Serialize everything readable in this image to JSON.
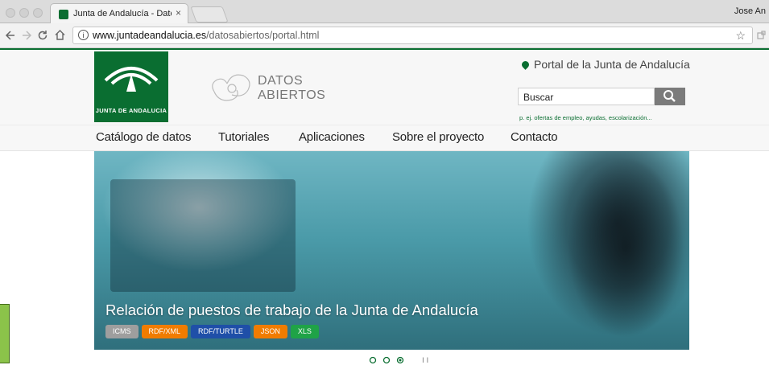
{
  "browser": {
    "tab_title": "Junta de Andalucía - Datos abi",
    "tab_close": "×",
    "user_name": "Jose An",
    "url_domain": "www.juntadeandalucia.es",
    "url_path": "/datosabiertos/portal.html",
    "info_glyph": "i",
    "star_glyph": "☆",
    "icons": [
      "back-arrow-icon",
      "forward-arrow-icon",
      "reload-icon",
      "home-icon",
      "info-icon",
      "star-icon",
      "extension-icon"
    ]
  },
  "header": {
    "logo_text": "JUNTA DE ANDALUCIA",
    "site_name_line1": "DATOS",
    "site_name_line2": "ABIERTOS",
    "portal_link": "Portal de la Junta de Andalucía",
    "search_value": "Buscar",
    "search_hint": "p. ej. ofertas de empleo, ayudas, escolarización..."
  },
  "nav": {
    "items": [
      {
        "label": "Catálogo de datos"
      },
      {
        "label": "Tutoriales"
      },
      {
        "label": "Aplicaciones"
      },
      {
        "label": "Sobre el proyecto"
      },
      {
        "label": "Contacto"
      }
    ]
  },
  "hero": {
    "title": "Relación de puestos de trabajo de la Junta de Andalucía",
    "tags": [
      {
        "label": "ICMS",
        "color": "#9e9e9e"
      },
      {
        "label": "RDF/XML",
        "color": "#f07c00"
      },
      {
        "label": "RDF/TURTLE",
        "color": "#1f4fa8"
      },
      {
        "label": "JSON",
        "color": "#f07c00"
      },
      {
        "label": "XLS",
        "color": "#1fa347"
      }
    ],
    "carousel": {
      "slides": 3,
      "active": 3,
      "pause_glyph": "II"
    }
  },
  "colors": {
    "brand_green": "#0a6e31",
    "link_green": "#0a6e31"
  }
}
